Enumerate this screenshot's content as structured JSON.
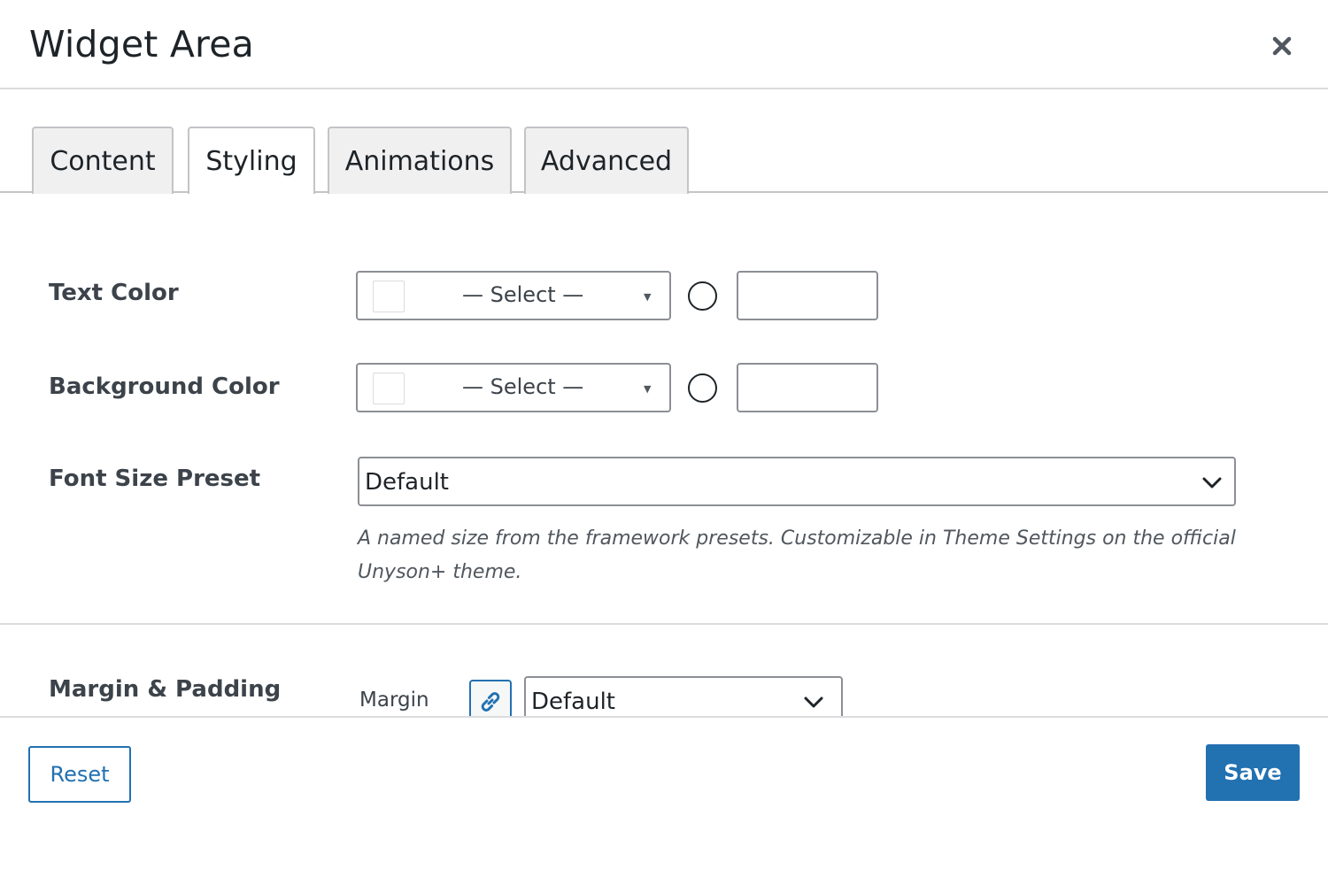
{
  "modal": {
    "title": "Widget Area",
    "close_icon": "close-icon"
  },
  "tabs": [
    {
      "label": "Content",
      "active": false
    },
    {
      "label": "Styling",
      "active": true
    },
    {
      "label": "Animations",
      "active": false
    },
    {
      "label": "Advanced",
      "active": false
    }
  ],
  "fields": {
    "text_color": {
      "label": "Text Color",
      "select_value": "— Select —",
      "hex_value": ""
    },
    "background_color": {
      "label": "Background Color",
      "select_value": "— Select —",
      "hex_value": ""
    },
    "font_size_preset": {
      "label": "Font Size Preset",
      "value": "Default",
      "help": "A named size from the framework presets. Customizable in Theme Settings on the official Unyson+ theme."
    },
    "margin_padding": {
      "label": "Margin & Padding",
      "sub_label": "Margin",
      "value": "Default",
      "link_icon": "link-icon"
    }
  },
  "footer": {
    "reset_label": "Reset",
    "save_label": "Save"
  },
  "colors": {
    "accent": "#2271b1",
    "text": "#1d2327",
    "border": "#8c8f94"
  }
}
